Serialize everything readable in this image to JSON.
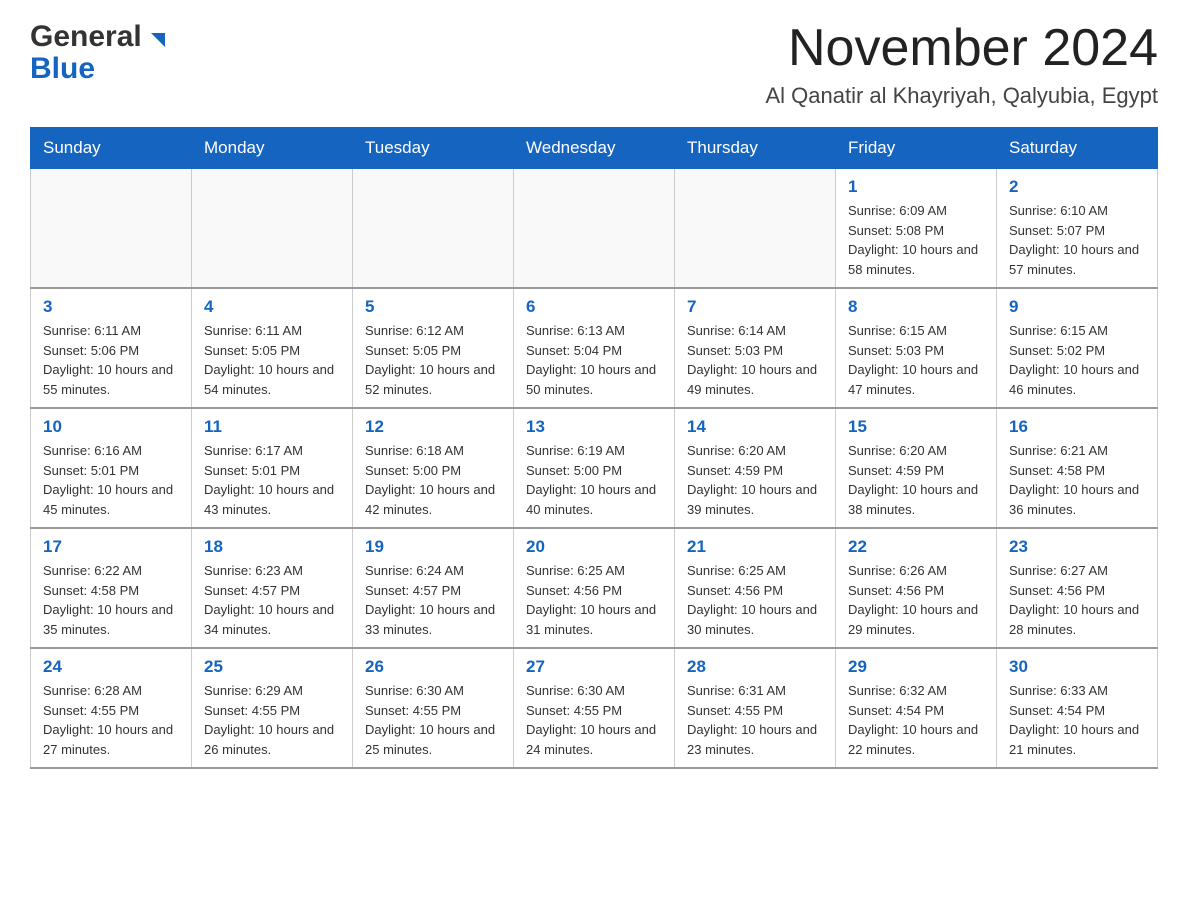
{
  "header": {
    "logo_general": "General",
    "logo_blue": "Blue",
    "month_title": "November 2024",
    "location": "Al Qanatir al Khayriyah, Qalyubia, Egypt"
  },
  "days_of_week": [
    "Sunday",
    "Monday",
    "Tuesday",
    "Wednesday",
    "Thursday",
    "Friday",
    "Saturday"
  ],
  "weeks": [
    [
      {
        "day": "",
        "sunrise": "",
        "sunset": "",
        "daylight": ""
      },
      {
        "day": "",
        "sunrise": "",
        "sunset": "",
        "daylight": ""
      },
      {
        "day": "",
        "sunrise": "",
        "sunset": "",
        "daylight": ""
      },
      {
        "day": "",
        "sunrise": "",
        "sunset": "",
        "daylight": ""
      },
      {
        "day": "",
        "sunrise": "",
        "sunset": "",
        "daylight": ""
      },
      {
        "day": "1",
        "sunrise": "Sunrise: 6:09 AM",
        "sunset": "Sunset: 5:08 PM",
        "daylight": "Daylight: 10 hours and 58 minutes."
      },
      {
        "day": "2",
        "sunrise": "Sunrise: 6:10 AM",
        "sunset": "Sunset: 5:07 PM",
        "daylight": "Daylight: 10 hours and 57 minutes."
      }
    ],
    [
      {
        "day": "3",
        "sunrise": "Sunrise: 6:11 AM",
        "sunset": "Sunset: 5:06 PM",
        "daylight": "Daylight: 10 hours and 55 minutes."
      },
      {
        "day": "4",
        "sunrise": "Sunrise: 6:11 AM",
        "sunset": "Sunset: 5:05 PM",
        "daylight": "Daylight: 10 hours and 54 minutes."
      },
      {
        "day": "5",
        "sunrise": "Sunrise: 6:12 AM",
        "sunset": "Sunset: 5:05 PM",
        "daylight": "Daylight: 10 hours and 52 minutes."
      },
      {
        "day": "6",
        "sunrise": "Sunrise: 6:13 AM",
        "sunset": "Sunset: 5:04 PM",
        "daylight": "Daylight: 10 hours and 50 minutes."
      },
      {
        "day": "7",
        "sunrise": "Sunrise: 6:14 AM",
        "sunset": "Sunset: 5:03 PM",
        "daylight": "Daylight: 10 hours and 49 minutes."
      },
      {
        "day": "8",
        "sunrise": "Sunrise: 6:15 AM",
        "sunset": "Sunset: 5:03 PM",
        "daylight": "Daylight: 10 hours and 47 minutes."
      },
      {
        "day": "9",
        "sunrise": "Sunrise: 6:15 AM",
        "sunset": "Sunset: 5:02 PM",
        "daylight": "Daylight: 10 hours and 46 minutes."
      }
    ],
    [
      {
        "day": "10",
        "sunrise": "Sunrise: 6:16 AM",
        "sunset": "Sunset: 5:01 PM",
        "daylight": "Daylight: 10 hours and 45 minutes."
      },
      {
        "day": "11",
        "sunrise": "Sunrise: 6:17 AM",
        "sunset": "Sunset: 5:01 PM",
        "daylight": "Daylight: 10 hours and 43 minutes."
      },
      {
        "day": "12",
        "sunrise": "Sunrise: 6:18 AM",
        "sunset": "Sunset: 5:00 PM",
        "daylight": "Daylight: 10 hours and 42 minutes."
      },
      {
        "day": "13",
        "sunrise": "Sunrise: 6:19 AM",
        "sunset": "Sunset: 5:00 PM",
        "daylight": "Daylight: 10 hours and 40 minutes."
      },
      {
        "day": "14",
        "sunrise": "Sunrise: 6:20 AM",
        "sunset": "Sunset: 4:59 PM",
        "daylight": "Daylight: 10 hours and 39 minutes."
      },
      {
        "day": "15",
        "sunrise": "Sunrise: 6:20 AM",
        "sunset": "Sunset: 4:59 PM",
        "daylight": "Daylight: 10 hours and 38 minutes."
      },
      {
        "day": "16",
        "sunrise": "Sunrise: 6:21 AM",
        "sunset": "Sunset: 4:58 PM",
        "daylight": "Daylight: 10 hours and 36 minutes."
      }
    ],
    [
      {
        "day": "17",
        "sunrise": "Sunrise: 6:22 AM",
        "sunset": "Sunset: 4:58 PM",
        "daylight": "Daylight: 10 hours and 35 minutes."
      },
      {
        "day": "18",
        "sunrise": "Sunrise: 6:23 AM",
        "sunset": "Sunset: 4:57 PM",
        "daylight": "Daylight: 10 hours and 34 minutes."
      },
      {
        "day": "19",
        "sunrise": "Sunrise: 6:24 AM",
        "sunset": "Sunset: 4:57 PM",
        "daylight": "Daylight: 10 hours and 33 minutes."
      },
      {
        "day": "20",
        "sunrise": "Sunrise: 6:25 AM",
        "sunset": "Sunset: 4:56 PM",
        "daylight": "Daylight: 10 hours and 31 minutes."
      },
      {
        "day": "21",
        "sunrise": "Sunrise: 6:25 AM",
        "sunset": "Sunset: 4:56 PM",
        "daylight": "Daylight: 10 hours and 30 minutes."
      },
      {
        "day": "22",
        "sunrise": "Sunrise: 6:26 AM",
        "sunset": "Sunset: 4:56 PM",
        "daylight": "Daylight: 10 hours and 29 minutes."
      },
      {
        "day": "23",
        "sunrise": "Sunrise: 6:27 AM",
        "sunset": "Sunset: 4:56 PM",
        "daylight": "Daylight: 10 hours and 28 minutes."
      }
    ],
    [
      {
        "day": "24",
        "sunrise": "Sunrise: 6:28 AM",
        "sunset": "Sunset: 4:55 PM",
        "daylight": "Daylight: 10 hours and 27 minutes."
      },
      {
        "day": "25",
        "sunrise": "Sunrise: 6:29 AM",
        "sunset": "Sunset: 4:55 PM",
        "daylight": "Daylight: 10 hours and 26 minutes."
      },
      {
        "day": "26",
        "sunrise": "Sunrise: 6:30 AM",
        "sunset": "Sunset: 4:55 PM",
        "daylight": "Daylight: 10 hours and 25 minutes."
      },
      {
        "day": "27",
        "sunrise": "Sunrise: 6:30 AM",
        "sunset": "Sunset: 4:55 PM",
        "daylight": "Daylight: 10 hours and 24 minutes."
      },
      {
        "day": "28",
        "sunrise": "Sunrise: 6:31 AM",
        "sunset": "Sunset: 4:55 PM",
        "daylight": "Daylight: 10 hours and 23 minutes."
      },
      {
        "day": "29",
        "sunrise": "Sunrise: 6:32 AM",
        "sunset": "Sunset: 4:54 PM",
        "daylight": "Daylight: 10 hours and 22 minutes."
      },
      {
        "day": "30",
        "sunrise": "Sunrise: 6:33 AM",
        "sunset": "Sunset: 4:54 PM",
        "daylight": "Daylight: 10 hours and 21 minutes."
      }
    ]
  ]
}
